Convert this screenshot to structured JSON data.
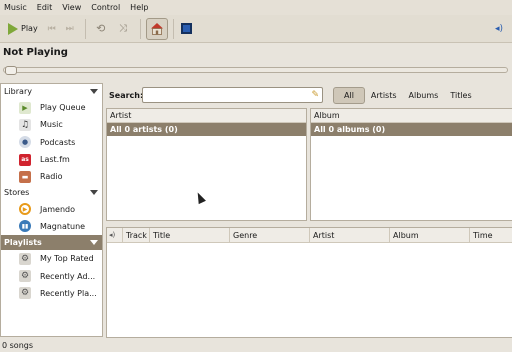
{
  "menubar": {
    "items": [
      "Music",
      "Edit",
      "View",
      "Control",
      "Help"
    ]
  },
  "toolbar": {
    "play_label": "Play"
  },
  "player": {
    "status": "Not Playing",
    "progress": 0
  },
  "search": {
    "label": "Search:",
    "value": ""
  },
  "filters": [
    "All",
    "Artists",
    "Albums",
    "Titles"
  ],
  "sidebar": {
    "library": {
      "title": "Library",
      "items": [
        "Play Queue",
        "Music",
        "Podcasts",
        "Last.fm",
        "Radio"
      ]
    },
    "stores": {
      "title": "Stores",
      "items": [
        "Jamendo",
        "Magnatune"
      ]
    },
    "playlists": {
      "title": "Playlists",
      "items": [
        "My Top Rated",
        "Recently Ad...",
        "Recently Pla..."
      ]
    }
  },
  "artist_pane": {
    "header": "Artist",
    "row": "All 0 artists (0)"
  },
  "album_pane": {
    "header": "Album",
    "row": "All 0 albums (0)"
  },
  "track_columns": [
    "Track",
    "Title",
    "Genre",
    "Artist",
    "Album",
    "Time"
  ],
  "statusbar": {
    "text": "0 songs"
  },
  "colors": {
    "selection": "#8c7f6b",
    "play_green": "#7fa83a",
    "accent_blue": "#2a5db0"
  }
}
